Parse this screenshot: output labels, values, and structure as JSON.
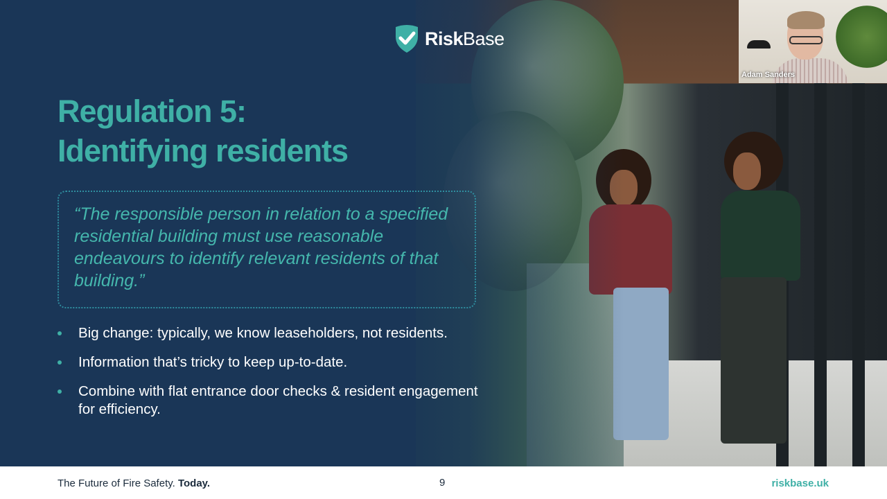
{
  "logo": {
    "brand_bold": "Risk",
    "brand_light": "Base",
    "accent": "#3fb0a6"
  },
  "slide": {
    "title_line1": "Regulation 5:",
    "title_line2": "Identifying residents",
    "quote": "“The responsible person in relation to a specified residential building must use reasonable endeavours to identify relevant residents of that building.”",
    "bullets": [
      "Big change: typically, we know leaseholders, not residents.",
      "Information that’s tricky to keep up-to-date.",
      "Combine with flat entrance door checks & resident engagement for efficiency."
    ]
  },
  "webcam": {
    "participant_name": "Adam Sanders"
  },
  "footer": {
    "tagline_regular": "The Future of Fire Safety.",
    "tagline_bold": "Today.",
    "page_number": "9",
    "url": "riskbase.uk"
  },
  "colors": {
    "background": "#1a3657",
    "accent": "#3fb0a6",
    "text": "#ffffff"
  }
}
